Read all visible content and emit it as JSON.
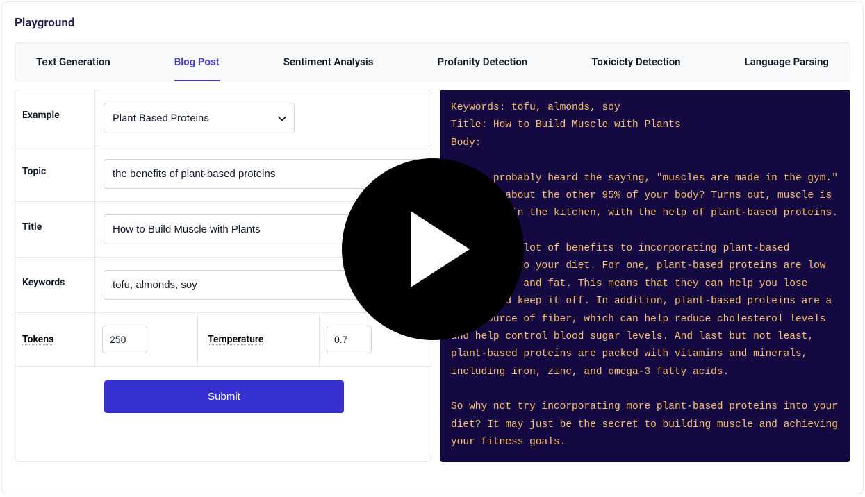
{
  "page_title": "Playground",
  "tabs": [
    {
      "label": "Text Generation",
      "active": false
    },
    {
      "label": "Blog Post",
      "active": true
    },
    {
      "label": "Sentiment Analysis",
      "active": false
    },
    {
      "label": "Profanity Detection",
      "active": false
    },
    {
      "label": "Toxicicty Detection",
      "active": false
    },
    {
      "label": "Language Parsing",
      "active": false
    }
  ],
  "form": {
    "example_label": "Example",
    "example_value": "Plant Based Proteins",
    "topic_label": "Topic",
    "topic_value": "the benefits of plant-based proteins",
    "title_label": "Title",
    "title_value": "How to Build Muscle with Plants",
    "keywords_label": "Keywords",
    "keywords_value": "tofu, almonds, soy",
    "tokens_label": "Tokens",
    "tokens_value": "250",
    "temperature_label": "Temperature",
    "temperature_value": "0.7",
    "submit_label": "Submit"
  },
  "output": {
    "keywords_line": "Keywords: tofu, almonds, soy",
    "title_line": "Title: How to Build Muscle with Plants",
    "body_label": "Body:",
    "body_p1": "You've probably heard the saying, \"muscles are made in the gym.\" But what about the other 95% of your body? Turns out, muscle is also made in the kitchen, with the help of plant-based proteins.",
    "body_p2": "There are a lot of benefits to incorporating plant-based proteins into your diet. For one, plant-based proteins are low in calories and fat. This means that they can help you lose weight and keep it off. In addition, plant-based proteins are a good source of fiber, which can help reduce cholesterol levels and help control blood sugar levels. And last but not least, plant-based proteins are packed with vitamins and minerals, including iron, zinc, and omega-3 fatty acids.",
    "body_p3": "So why not try incorporating more plant-based proteins into your diet? It may just be the secret to building muscle and achieving your fitness goals."
  },
  "colors": {
    "primary": "#3730d0",
    "output_bg": "#140941",
    "output_text": "#fbbf6e"
  }
}
